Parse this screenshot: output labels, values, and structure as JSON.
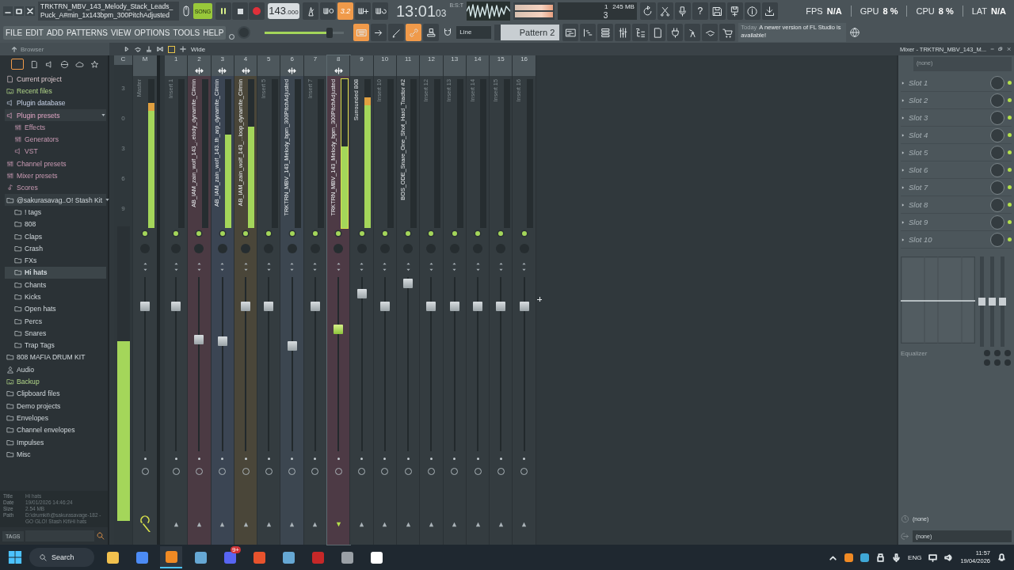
{
  "title_bar": {
    "project": "TRKTRN_MBV_143_Melody_Stack_Leads_Puck_A#min_1x143bpm_300PitchAdjusted"
  },
  "transport": {
    "mode": "SONG",
    "song_mode": true,
    "playing": true,
    "tempo_main": "143",
    "tempo_fraction": ".000"
  },
  "tools_left": [
    {
      "kind": "metronome",
      "on": false
    },
    {
      "kind": "wait",
      "on": false
    },
    {
      "kind": "countin",
      "on": true,
      "label": "3.2"
    },
    {
      "kind": "step",
      "on": false
    },
    {
      "kind": "loop",
      "on": false
    }
  ],
  "clock": {
    "main": "13:01",
    "sub": "03",
    "unit": "B:S:T"
  },
  "memory": {
    "readout_1": "1",
    "ram": "245 MB",
    "readout_2": "3"
  },
  "tools_right": [
    {
      "kind": "undo",
      "on": false
    },
    {
      "kind": "cut",
      "on": false
    },
    {
      "kind": "mic",
      "on": false
    },
    {
      "kind": "help",
      "on": false,
      "label": "?"
    },
    {
      "kind": "save",
      "on": false
    },
    {
      "kind": "export",
      "on": false
    },
    {
      "kind": "info",
      "on": false
    },
    {
      "kind": "download",
      "on": false
    }
  ],
  "stats": [
    {
      "label": "FPS",
      "value": "N/A"
    },
    {
      "label": "GPU",
      "value": "8 %"
    },
    {
      "label": "CPU",
      "value": "8 %"
    },
    {
      "label": "LAT",
      "value": "N/A"
    }
  ],
  "menu": [
    "FILE",
    "EDIT",
    "ADD",
    "PATTERNS",
    "VIEW",
    "OPTIONS",
    "TOOLS",
    "HELP"
  ],
  "master_volume": {
    "level": 0.82
  },
  "edit_tools": [
    {
      "kind": "typing",
      "on": true
    },
    {
      "kind": "arrow",
      "on": false
    },
    {
      "kind": "pen",
      "on": false
    },
    {
      "kind": "link",
      "on": true
    },
    {
      "kind": "stamp",
      "on": false
    }
  ],
  "snap": "Line",
  "pattern": "Pattern 2",
  "window_tools": [
    {
      "kind": "playlist",
      "on": false
    },
    {
      "kind": "pianoroll",
      "on": false
    },
    {
      "kind": "channelrack",
      "on": false
    },
    {
      "kind": "mixer",
      "on": false
    },
    {
      "kind": "browser",
      "on": false
    },
    {
      "kind": "project",
      "on": false
    },
    {
      "kind": "plugin",
      "on": false
    },
    {
      "kind": "pluginpicker",
      "on": false
    },
    {
      "kind": "touch",
      "on": false
    },
    {
      "kind": "shop",
      "on": false
    }
  ],
  "notice": {
    "when": "Today",
    "text": "A newer version of FL Studio is available!"
  },
  "browser": {
    "title": "Browser",
    "items": [
      {
        "label": "Current project",
        "kind": "project",
        "selected": false,
        "expanded": false
      },
      {
        "label": "Recent files",
        "kind": "recent",
        "selected": false,
        "expanded": false
      },
      {
        "label": "Plugin database",
        "kind": "database",
        "selected": false,
        "expanded": false
      },
      {
        "label": "Plugin presets",
        "kind": "presets",
        "selected": false,
        "expanded": true,
        "children": [
          {
            "label": "Effects",
            "kind": "preset",
            "selected": false,
            "expanded": false
          },
          {
            "label": "Generators",
            "kind": "preset",
            "selected": false,
            "expanded": false
          },
          {
            "label": "VST",
            "kind": "vst",
            "selected": false,
            "expanded": false
          }
        ]
      },
      {
        "label": "Channel presets",
        "kind": "preset",
        "selected": false,
        "expanded": false
      },
      {
        "label": "Mixer presets",
        "kind": "preset",
        "selected": false,
        "expanded": false
      },
      {
        "label": "Scores",
        "kind": "score",
        "selected": false,
        "expanded": false
      },
      {
        "label": "@sakurasavag..O! Stash Kit",
        "kind": "folder",
        "selected": false,
        "expanded": true,
        "children": [
          {
            "label": "! tags",
            "kind": "folder",
            "selected": false,
            "expanded": false
          },
          {
            "label": "808",
            "kind": "folder",
            "selected": false,
            "expanded": false
          },
          {
            "label": "Claps",
            "kind": "folder",
            "selected": false,
            "expanded": false
          },
          {
            "label": "Crash",
            "kind": "folder",
            "selected": false,
            "expanded": false
          },
          {
            "label": "FXs",
            "kind": "folder",
            "selected": false,
            "expanded": false
          },
          {
            "label": "Hi hats",
            "kind": "folder",
            "selected": true,
            "expanded": false
          },
          {
            "label": "Chants",
            "kind": "folder",
            "selected": false,
            "expanded": false
          },
          {
            "label": "Kicks",
            "kind": "folder",
            "selected": false,
            "expanded": false
          },
          {
            "label": "Open hats",
            "kind": "folder",
            "selected": false,
            "expanded": false
          },
          {
            "label": "Percs",
            "kind": "folder",
            "selected": false,
            "expanded": false
          },
          {
            "label": "Snares",
            "kind": "folder",
            "selected": false,
            "expanded": false
          },
          {
            "label": "Trap Tags",
            "kind": "folder",
            "selected": false,
            "expanded": false
          }
        ]
      },
      {
        "label": "808 MAFIA DRUM KIT",
        "kind": "folder",
        "selected": false,
        "expanded": false
      },
      {
        "label": "Audio",
        "kind": "user",
        "selected": false,
        "expanded": false
      },
      {
        "label": "Backup",
        "kind": "recent",
        "selected": false,
        "expanded": false
      },
      {
        "label": "Clipboard files",
        "kind": "folder",
        "selected": false,
        "expanded": false
      },
      {
        "label": "Demo projects",
        "kind": "folder",
        "selected": false,
        "expanded": false
      },
      {
        "label": "Envelopes",
        "kind": "folder",
        "selected": false,
        "expanded": false
      },
      {
        "label": "Channel envelopes",
        "kind": "folder",
        "selected": false,
        "expanded": false
      },
      {
        "label": "Impulses",
        "kind": "folder",
        "selected": false,
        "expanded": false
      },
      {
        "label": "Misc",
        "kind": "folder",
        "selected": false,
        "expanded": false
      }
    ],
    "info": [
      {
        "label": "Title",
        "value": "Hi hats"
      },
      {
        "label": "Date",
        "value": "19/01/2026 14:46:24"
      },
      {
        "label": "Size",
        "value": "2.54 MB"
      },
      {
        "label": "Path",
        "value": "D:\\drumkit\\@sakurasavage-182 - GO GLO! Stash Kit\\Hi hats"
      }
    ],
    "tags_button": "TAGS"
  },
  "mixer": {
    "view": "Wide",
    "scale": [
      "3",
      "0",
      "3",
      "6",
      "9"
    ],
    "strips": [
      {
        "kind": "current",
        "number": "C",
        "meter": {
          "level": 0.61
        }
      },
      {
        "kind": "master",
        "number": "M",
        "name": "Master",
        "named": false,
        "meter": {
          "level": 0.84
        },
        "fader": {
          "level": 0.85
        },
        "linked": false,
        "selected": false
      },
      {
        "kind": "insert",
        "number": "1",
        "name": "Insert 1",
        "named": false,
        "meter": {
          "level": 0
        },
        "fader": {
          "level": 0.85
        },
        "linked": false,
        "selected": false
      },
      {
        "kind": "insert",
        "number": "2",
        "name": "AB_IAM_zain_wolf_143_..elody_dynamite_C#min",
        "named": true,
        "color": "#4b3a43",
        "meter": {
          "level": 0
        },
        "fader": {
          "level": 0.65
        },
        "linked": true,
        "selected": false
      },
      {
        "kind": "insert",
        "number": "3",
        "name": "AB_IAM_zain_wolf_143..th_arp_dynamite_C#min",
        "named": true,
        "color": "#3b4553",
        "meter": {
          "level": 0.63
        },
        "fader": {
          "level": 0.64
        },
        "linked": true,
        "selected": false
      },
      {
        "kind": "insert",
        "number": "4",
        "name": "AB_IAM_zain_wolf_143_...loop_dynamite_C#min",
        "named": true,
        "color": "#4a4639",
        "meter": {
          "level": 0.68
        },
        "fader": {
          "level": 0.85
        },
        "linked": true,
        "selected": false
      },
      {
        "kind": "insert",
        "number": "5",
        "name": "Insert 5",
        "named": false,
        "meter": {
          "level": 0
        },
        "fader": {
          "level": 0.85
        },
        "linked": false,
        "selected": false
      },
      {
        "kind": "insert",
        "number": "6",
        "name": "TRKTRN_MBV_143_Melody_bpm_300PitchAdjusted",
        "named": true,
        "color": "#3c4650",
        "meter": {
          "level": 0
        },
        "fader": {
          "level": 0.61
        },
        "linked": true,
        "selected": false
      },
      {
        "kind": "insert",
        "number": "7",
        "name": "Insert 7",
        "named": false,
        "meter": {
          "level": 0
        },
        "fader": {
          "level": 0.85
        },
        "linked": false,
        "selected": false
      },
      {
        "kind": "insert",
        "number": "8",
        "name": "TRKTRN_MBV_143_Melody_bpm_300PitchAdjusted",
        "named": true,
        "color": "#4d3a45",
        "meter": {
          "level": 0.55
        },
        "fader": {
          "level": 0.71
        },
        "linked": true,
        "selected": true
      },
      {
        "kind": "insert",
        "number": "9",
        "name": "Surrounded 808",
        "named": true,
        "meter": {
          "level": 0.88
        },
        "fader": {
          "level": 0.93
        },
        "linked": false,
        "selected": false
      },
      {
        "kind": "insert",
        "number": "10",
        "name": "Insert 10",
        "named": false,
        "meter": {
          "level": 0
        },
        "fader": {
          "level": 0.85
        },
        "linked": false,
        "selected": false
      },
      {
        "kind": "insert",
        "number": "11",
        "name": "BOS_ODE_Snare_One_Shot_Hard_Tractor #2",
        "named": true,
        "meter": {
          "level": 0
        },
        "fader": {
          "level": 0.99
        },
        "linked": false,
        "selected": false
      },
      {
        "kind": "insert",
        "number": "12",
        "name": "Insert 12",
        "named": false,
        "meter": {
          "level": 0
        },
        "fader": {
          "level": 0.85
        },
        "linked": false,
        "selected": false
      },
      {
        "kind": "insert",
        "number": "13",
        "name": "Insert 13",
        "named": false,
        "meter": {
          "level": 0
        },
        "fader": {
          "level": 0.85
        },
        "linked": false,
        "selected": false
      },
      {
        "kind": "insert",
        "number": "14",
        "name": "Insert 14",
        "named": false,
        "meter": {
          "level": 0
        },
        "fader": {
          "level": 0.85
        },
        "linked": false,
        "selected": false
      },
      {
        "kind": "insert",
        "number": "15",
        "name": "Insert 15",
        "named": false,
        "meter": {
          "level": 0
        },
        "fader": {
          "level": 0.85
        },
        "linked": false,
        "selected": false
      },
      {
        "kind": "insert",
        "number": "16",
        "name": "Insert 16",
        "named": false,
        "meter": {
          "level": 0
        },
        "fader": {
          "level": 0.85
        },
        "linked": false,
        "selected": false
      }
    ]
  },
  "mixer_panel": {
    "title": "Mixer - TRKTRN_MBV_143_M...",
    "preset": "(none)",
    "slots": [
      {
        "name": "Slot 1",
        "on": true
      },
      {
        "name": "Slot 2",
        "on": true
      },
      {
        "name": "Slot 3",
        "on": true
      },
      {
        "name": "Slot 4",
        "on": true
      },
      {
        "name": "Slot 5",
        "on": true
      },
      {
        "name": "Slot 6",
        "on": true
      },
      {
        "name": "Slot 7",
        "on": true
      },
      {
        "name": "Slot 8",
        "on": true
      },
      {
        "name": "Slot 9",
        "on": true
      },
      {
        "name": "Slot 10",
        "on": true
      }
    ],
    "eq_bands": [
      {
        "level": 0.5
      },
      {
        "level": 0.5
      },
      {
        "level": 0.5
      }
    ],
    "eq_label": "Equalizer",
    "input": "(none)",
    "output": "(none)"
  },
  "taskbar": {
    "search": "Search",
    "apps": [
      {
        "kind": "folder",
        "active": false
      },
      {
        "kind": "globe",
        "active": false
      },
      {
        "kind": "daw",
        "active": true
      },
      {
        "kind": "steam",
        "active": false
      },
      {
        "kind": "chat",
        "active": false,
        "badge": "9+"
      },
      {
        "kind": "flag",
        "active": false
      },
      {
        "kind": "steam",
        "active": false
      },
      {
        "kind": "shield",
        "active": false
      },
      {
        "kind": "disc",
        "active": false
      },
      {
        "kind": "bolt",
        "active": false
      }
    ],
    "language": "ENG",
    "time": "11:57",
    "date": "19/04/2026"
  }
}
